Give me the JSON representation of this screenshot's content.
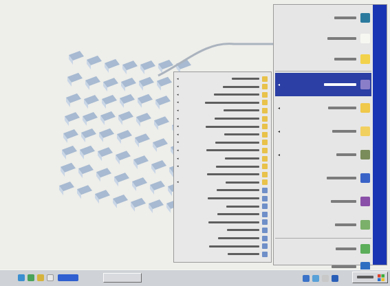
{
  "colors": {
    "desktop_bg": "#eeeeea",
    "banner": "#1a35b3",
    "highlight": "#2b3fa5",
    "menu_bg": "#e6e6e6",
    "taskbar": "#cfd2d6"
  },
  "start_menu": {
    "banner_text": "",
    "top_items": [
      {
        "label": "",
        "icon": "windows-update-icon",
        "color": "#2b7a9e"
      },
      {
        "label": "",
        "icon": "document-icon",
        "color": "#f7f7f2"
      },
      {
        "label": "",
        "icon": "folder-icon",
        "color": "#f2d24b"
      }
    ],
    "items": [
      {
        "label": "",
        "icon": "programs-icon",
        "color": "#8a7ec8",
        "submenu": true,
        "highlighted": true
      },
      {
        "label": "",
        "icon": "documents-folder-icon",
        "color": "#f0c84a",
        "submenu": true
      },
      {
        "label": "",
        "icon": "settings-folder-icon",
        "color": "#f2d060",
        "submenu": true
      },
      {
        "label": "",
        "icon": "search-icon",
        "color": "#7a8c5a",
        "submenu": true
      },
      {
        "label": "",
        "icon": "help-icon",
        "color": "#3a63c8",
        "submenu": false
      },
      {
        "label": "",
        "icon": "run-icon",
        "color": "#8a4fa8",
        "submenu": false
      },
      {
        "label": "",
        "icon": "log-off-icon",
        "color": "#7bb06a",
        "submenu": false
      }
    ],
    "bottom_items": [
      {
        "label": "",
        "icon": "shutdown-icon",
        "color": "#5cae5a"
      },
      {
        "label": "",
        "icon": "computer-icon",
        "color": "#2f6fc2"
      }
    ]
  },
  "programs_submenu": {
    "items": [
      {
        "label": "",
        "icon": "folder-icon",
        "submenu": true
      },
      {
        "label": "",
        "icon": "folder-icon",
        "submenu": true
      },
      {
        "label": "",
        "icon": "folder-icon",
        "submenu": true
      },
      {
        "label": "",
        "icon": "folder-icon",
        "submenu": true
      },
      {
        "label": "",
        "icon": "folder-icon",
        "submenu": true
      },
      {
        "label": "",
        "icon": "folder-icon",
        "submenu": true
      },
      {
        "label": "",
        "icon": "folder-icon",
        "submenu": true
      },
      {
        "label": "",
        "icon": "folder-icon",
        "submenu": true
      },
      {
        "label": "",
        "icon": "folder-icon",
        "submenu": true
      },
      {
        "label": "",
        "icon": "folder-icon",
        "submenu": true
      },
      {
        "label": "",
        "icon": "folder-icon",
        "submenu": true
      },
      {
        "label": "",
        "icon": "folder-icon",
        "submenu": true
      },
      {
        "label": "",
        "icon": "folder-icon",
        "submenu": false
      },
      {
        "label": "",
        "icon": "folder-icon",
        "submenu": true
      },
      {
        "label": "",
        "icon": "app-icon",
        "submenu": false
      },
      {
        "label": "",
        "icon": "app-icon",
        "submenu": false
      },
      {
        "label": "",
        "icon": "app-icon",
        "submenu": false
      },
      {
        "label": "",
        "icon": "app-icon",
        "submenu": false
      },
      {
        "label": "",
        "icon": "app-icon",
        "submenu": false
      },
      {
        "label": "",
        "icon": "app-icon",
        "submenu": false
      },
      {
        "label": "",
        "icon": "app-icon",
        "submenu": false
      },
      {
        "label": "",
        "icon": "app-icon",
        "submenu": false
      },
      {
        "label": "",
        "icon": "app-icon",
        "submenu": false
      }
    ]
  },
  "taskbar": {
    "clock": "",
    "start_label": "",
    "task_button_label": ""
  }
}
